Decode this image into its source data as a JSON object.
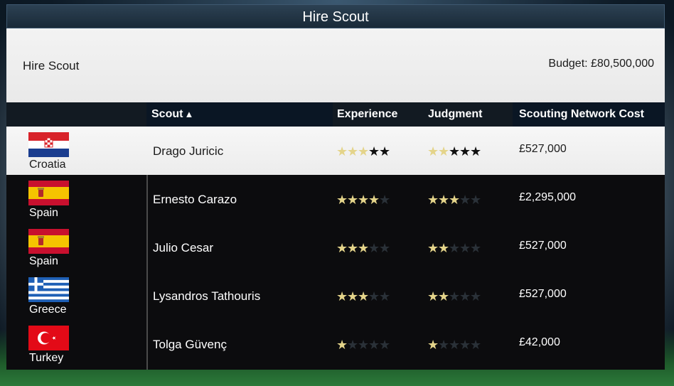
{
  "screen": {
    "title": "Hire Scout",
    "panel_title": "Hire Scout",
    "budget": "Budget: £80,500,000"
  },
  "columns": {
    "scout": "Scout",
    "sort_indicator": "▲",
    "experience": "Experience",
    "judgment": "Judgment",
    "cost": "Scouting Network Cost"
  },
  "scouts": [
    {
      "country": "Croatia",
      "flag": "croatia-flag",
      "name": "Drago Juricic",
      "experience": 3,
      "judgment": 2,
      "cost": "£527,000",
      "selected": true
    },
    {
      "country": "Spain",
      "flag": "spain-flag",
      "name": "Ernesto Carazo",
      "experience": 4,
      "judgment": 3,
      "cost": "£2,295,000",
      "selected": false
    },
    {
      "country": "Spain",
      "flag": "spain-flag",
      "name": "Julio Cesar",
      "experience": 3,
      "judgment": 2,
      "cost": "£527,000",
      "selected": false
    },
    {
      "country": "Greece",
      "flag": "greece-flag",
      "name": "Lysandros Tathouris",
      "experience": 3,
      "judgment": 2,
      "cost": "£527,000",
      "selected": false
    },
    {
      "country": "Turkey",
      "flag": "turkey-flag",
      "name": "Tolga Güvenç",
      "experience": 1,
      "judgment": 1,
      "cost": "£42,000",
      "selected": false
    }
  ],
  "max_stars": 5,
  "colors": {
    "star_on": "#e4d48a",
    "header_bg": "#0a1624",
    "row_selected_bg": "#f2f2f2"
  }
}
